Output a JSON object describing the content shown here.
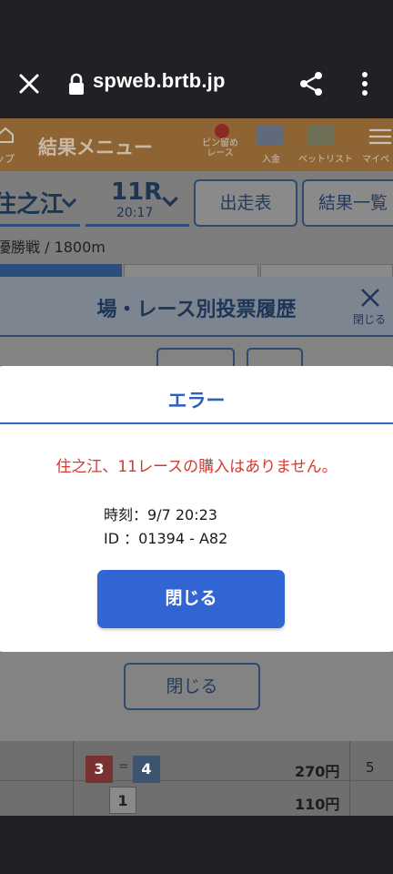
{
  "browser": {
    "url": "spweb.brtb.jp"
  },
  "nav": {
    "home_label": "ップ",
    "menu_title": "結果メニュー",
    "items": [
      {
        "label": "ピン留め\nレース"
      },
      {
        "label": "入金"
      },
      {
        "label": "ベットリスト"
      },
      {
        "label": "マイペ"
      }
    ]
  },
  "race": {
    "venue": "住之江",
    "race_number": "11R",
    "race_time": "20:17",
    "entries_button": "出走表",
    "results_button": "結果一覧",
    "subtitle": "優勝戦 / 1800m"
  },
  "history_modal": {
    "title": "場・レース別投票履歴",
    "close_icon_label": "閉じる",
    "close_button": "閉じる"
  },
  "results_rows": [
    {
      "first": "3",
      "second": "4",
      "payout": "270円",
      "popularity": "5"
    },
    {
      "first": "1",
      "payout": "110円"
    }
  ],
  "colors": {
    "accent": "#3165d3",
    "error_text": "#d43a2f",
    "boat3": "#c0392b",
    "boat4": "#2f6db5"
  },
  "error_dialog": {
    "title": "エラー",
    "message": "住之江、11レースの購入はありません。",
    "time_line": "時刻：9/7 20:23",
    "id_line": "ID ：01394 - A82",
    "close_button": "閉じる"
  }
}
